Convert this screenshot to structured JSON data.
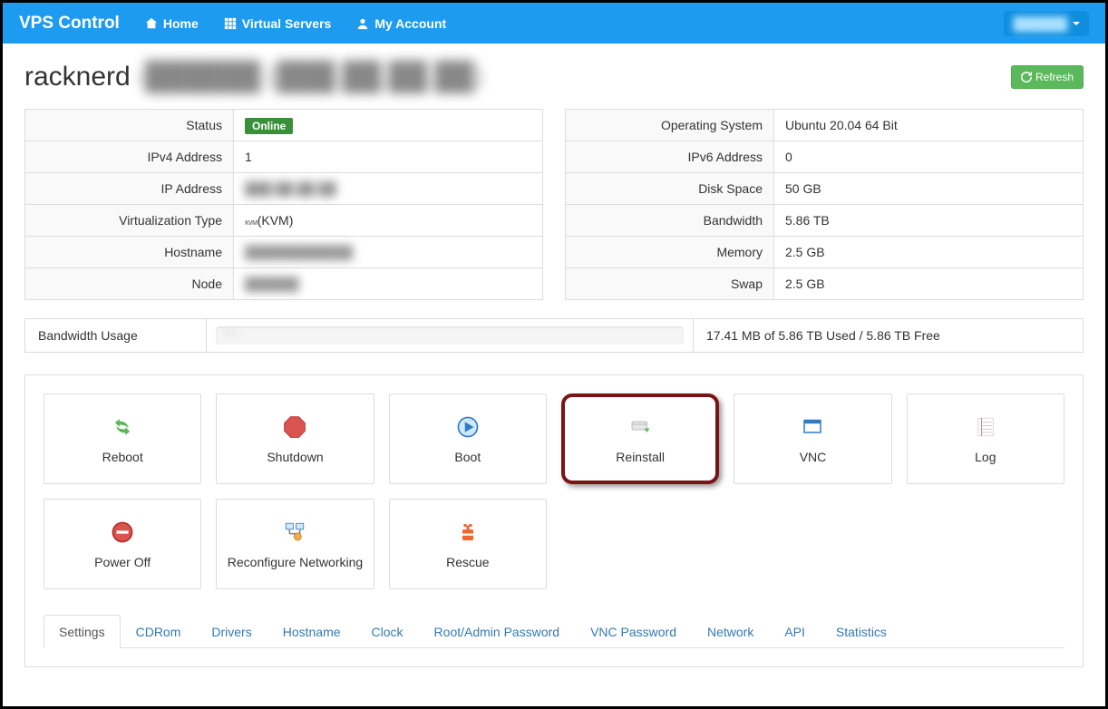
{
  "nav": {
    "brand": "VPS Control",
    "home": "Home",
    "servers": "Virtual Servers",
    "account": "My Account",
    "user": "██████"
  },
  "header": {
    "title_prefix": "racknerd",
    "title_blur": "-██████ (███.██.██.██)",
    "refresh": "Refresh"
  },
  "left_table": {
    "status_k": "Status",
    "status_v": "Online",
    "ipv4_k": "IPv4 Address",
    "ipv4_v": "1",
    "ip_k": "IP Address",
    "ip_v": "███.██.██.██",
    "virt_k": "Virtualization Type",
    "virt_prefix": "ᴋᴠᴍ",
    "virt_v": "(KVM)",
    "host_k": "Hostname",
    "host_v": "████████████",
    "node_k": "Node",
    "node_v": "██████"
  },
  "right_table": {
    "os_k": "Operating System",
    "os_v": "Ubuntu 20.04 64 Bit",
    "ipv6_k": "IPv6 Address",
    "ipv6_v": "0",
    "disk_k": "Disk Space",
    "disk_v": "50 GB",
    "bw_k": "Bandwidth",
    "bw_v": "5.86 TB",
    "mem_k": "Memory",
    "mem_v": "2.5 GB",
    "swap_k": "Swap",
    "swap_v": "2.5 GB"
  },
  "bandwidth": {
    "label": "Bandwidth Usage",
    "pct": "0%",
    "text": "17.41 MB of 5.86 TB Used / 5.86 TB Free"
  },
  "actions": {
    "reboot": "Reboot",
    "shutdown": "Shutdown",
    "boot": "Boot",
    "reinstall": "Reinstall",
    "vnc": "VNC",
    "log": "Log",
    "poweroff": "Power Off",
    "reconfig": "Reconfigure Networking",
    "rescue": "Rescue"
  },
  "tabs": {
    "settings": "Settings",
    "cdrom": "CDRom",
    "drivers": "Drivers",
    "hostname": "Hostname",
    "clock": "Clock",
    "rootpw": "Root/Admin Password",
    "vncpw": "VNC Password",
    "network": "Network",
    "api": "API",
    "stats": "Statistics"
  }
}
